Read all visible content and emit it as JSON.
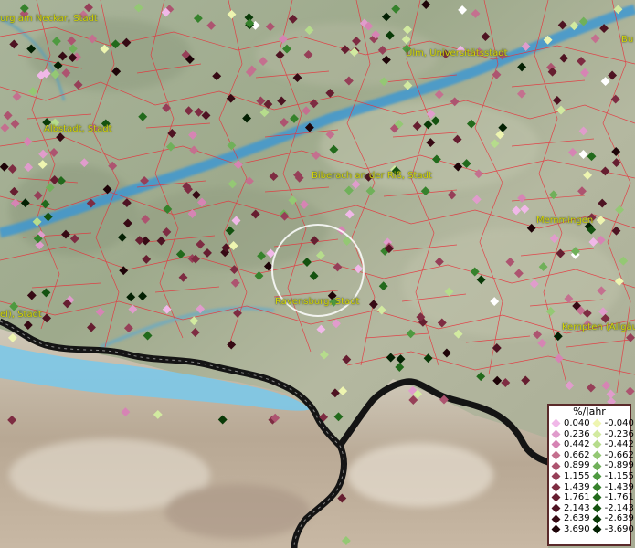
{
  "cities": [
    {
      "name": "urg am Neckar, Stadt"
    },
    {
      "name": "Ulm, Universitätsstadt"
    },
    {
      "name": "Albstadt, Stadt"
    },
    {
      "name": "Biberach an der Riß, Stadt"
    },
    {
      "name": "Memmingen"
    },
    {
      "name": "Ravensburg, Stadt"
    },
    {
      "name": "el), Stadt"
    },
    {
      "name": "Kempten (Allgäu)"
    },
    {
      "name": "Bu"
    }
  ],
  "legend": {
    "title": "%/Jahr",
    "positive": [
      {
        "label": "0.040",
        "color": "#f0b8e8"
      },
      {
        "label": "0.236",
        "color": "#e09ccc"
      },
      {
        "label": "0.442",
        "color": "#d684b4"
      },
      {
        "label": "0.662",
        "color": "#c4708f"
      },
      {
        "label": "0.899",
        "color": "#ad5470"
      },
      {
        "label": "1.155",
        "color": "#963f58"
      },
      {
        "label": "1.439",
        "color": "#7e2c42"
      },
      {
        "label": "1.761",
        "color": "#661e30"
      },
      {
        "label": "2.143",
        "color": "#4e1322"
      },
      {
        "label": "2.639",
        "color": "#360a14"
      },
      {
        "label": "3.690",
        "color": "#1e0408"
      }
    ],
    "negative": [
      {
        "label": "-0.040",
        "color": "#eef5b0"
      },
      {
        "label": "-0.236",
        "color": "#d2eaa0"
      },
      {
        "label": "-0.442",
        "color": "#b6dc8c"
      },
      {
        "label": "-0.662",
        "color": "#94c874"
      },
      {
        "label": "-0.899",
        "color": "#70b05a"
      },
      {
        "label": "-1.155",
        "color": "#4e9a40"
      },
      {
        "label": "-1.439",
        "color": "#36822c"
      },
      {
        "label": "-1.761",
        "color": "#226a1c"
      },
      {
        "label": "-2.143",
        "color": "#145210"
      },
      {
        "label": "-2.639",
        "color": "#0a3a08"
      },
      {
        "label": "-3.690",
        "color": "#032003"
      }
    ]
  },
  "colors": {
    "boundary": "#e8303a",
    "river": "#3a96d4",
    "lake": "#7cc8e8",
    "national_border": "#141414",
    "city_label": "#d4d40a"
  }
}
